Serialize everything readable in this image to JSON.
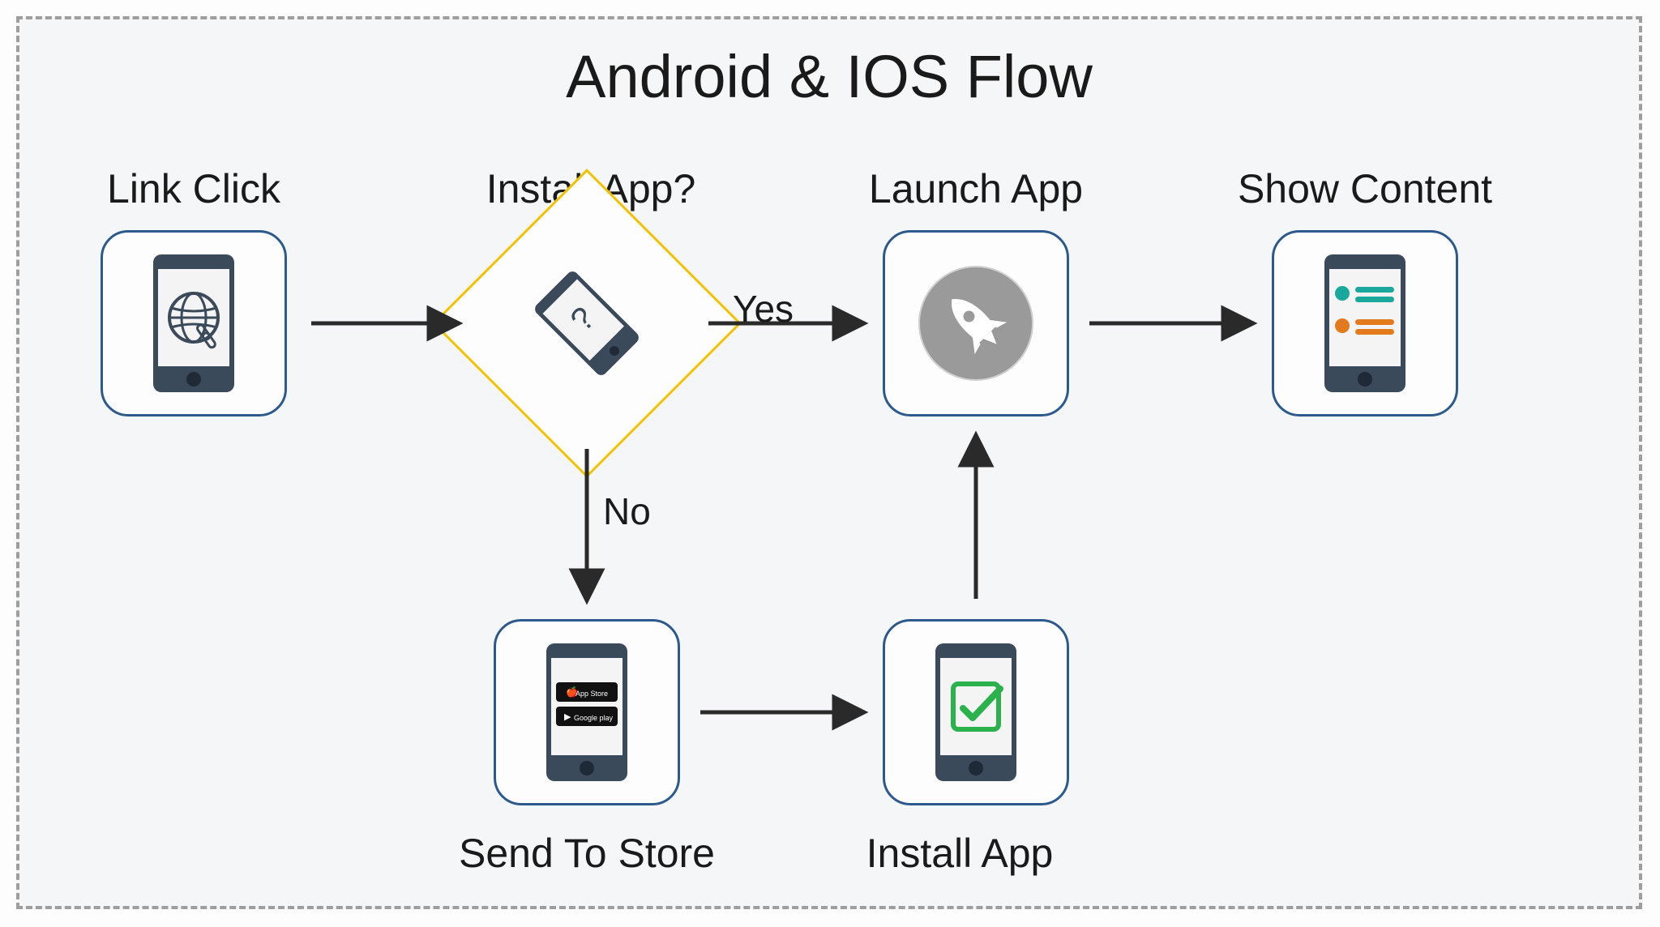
{
  "title": "Android & IOS Flow",
  "nodes": {
    "link_click": {
      "label": "Link Click"
    },
    "install_q": {
      "label": "Install App?"
    },
    "launch": {
      "label": "Launch App"
    },
    "show": {
      "label": "Show Content"
    },
    "store": {
      "label": "Send To Store"
    },
    "install": {
      "label": "Install App"
    }
  },
  "edges": {
    "yes": "Yes",
    "no": "No"
  },
  "store_badges": {
    "apple": "App Store",
    "google": "Google play"
  },
  "question_mark": "?"
}
